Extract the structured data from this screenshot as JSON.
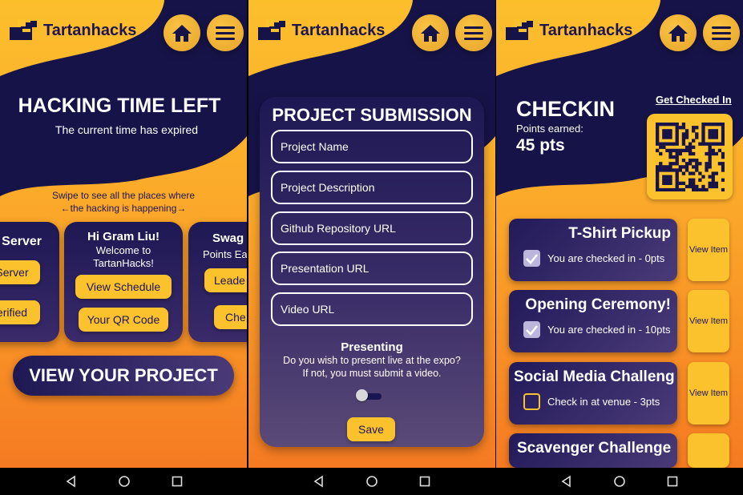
{
  "brand": {
    "name": "Tartanhacks"
  },
  "colors": {
    "navy": "#161348",
    "yellow": "#fcc22d",
    "orange": "#f57a22"
  },
  "screen1": {
    "title": "HACKING TIME LEFT",
    "subtitle": "The current time has expired",
    "swipe_line1": "Swipe to see all the places where",
    "swipe_line2": "←the hacking is happening→",
    "left_card": {
      "title": "l Server",
      "button1": "Server",
      "button2": "erified"
    },
    "center_card": {
      "greeting": "Hi Gram Liu!",
      "welcome1": "Welcome to",
      "welcome2": "TartanHacks!",
      "button1": "View Schedule",
      "button2": "Your QR Code"
    },
    "right_card": {
      "title": "Swag I",
      "subtitle": "Points Ea",
      "button1": "Leade",
      "button2": "Che"
    },
    "view_project": "VIEW YOUR PROJECT"
  },
  "screen2": {
    "title": "PROJECT SUBMISSION",
    "fields": [
      {
        "placeholder": "Project Name"
      },
      {
        "placeholder": "Project Description"
      },
      {
        "placeholder": "Github Repository URL"
      },
      {
        "placeholder": "Presentation URL"
      },
      {
        "placeholder": "Video URL"
      }
    ],
    "presenting_title": "Presenting",
    "presenting_line1": "Do you wish to present live at the expo?",
    "presenting_line2": "If not, you must submit a video.",
    "presenting_toggle": false,
    "save": "Save"
  },
  "screen3": {
    "title": "CHECKIN",
    "points_label": "Points earned:",
    "points_value": "45 pts",
    "get_checked_in": "Get Checked In",
    "items": [
      {
        "title": "T-Shirt Pickup",
        "status": "You are checked in - 0pts",
        "checked": true,
        "view": "View Item"
      },
      {
        "title": "Opening Ceremony!",
        "status": "You are checked in - 10pts",
        "checked": true,
        "view": "View Item"
      },
      {
        "title": "Social Media Challeng",
        "status": "Check in at venue - 3pts",
        "checked": false,
        "view": "View Item"
      },
      {
        "title": "Scavenger Challenge",
        "status": "",
        "checked": false,
        "view": ""
      }
    ]
  },
  "icons": [
    "logo-icon",
    "home-icon",
    "menu-icon",
    "checkbox-icon",
    "qr-code-icon",
    "back-icon",
    "home-nav-icon",
    "recents-icon"
  ]
}
